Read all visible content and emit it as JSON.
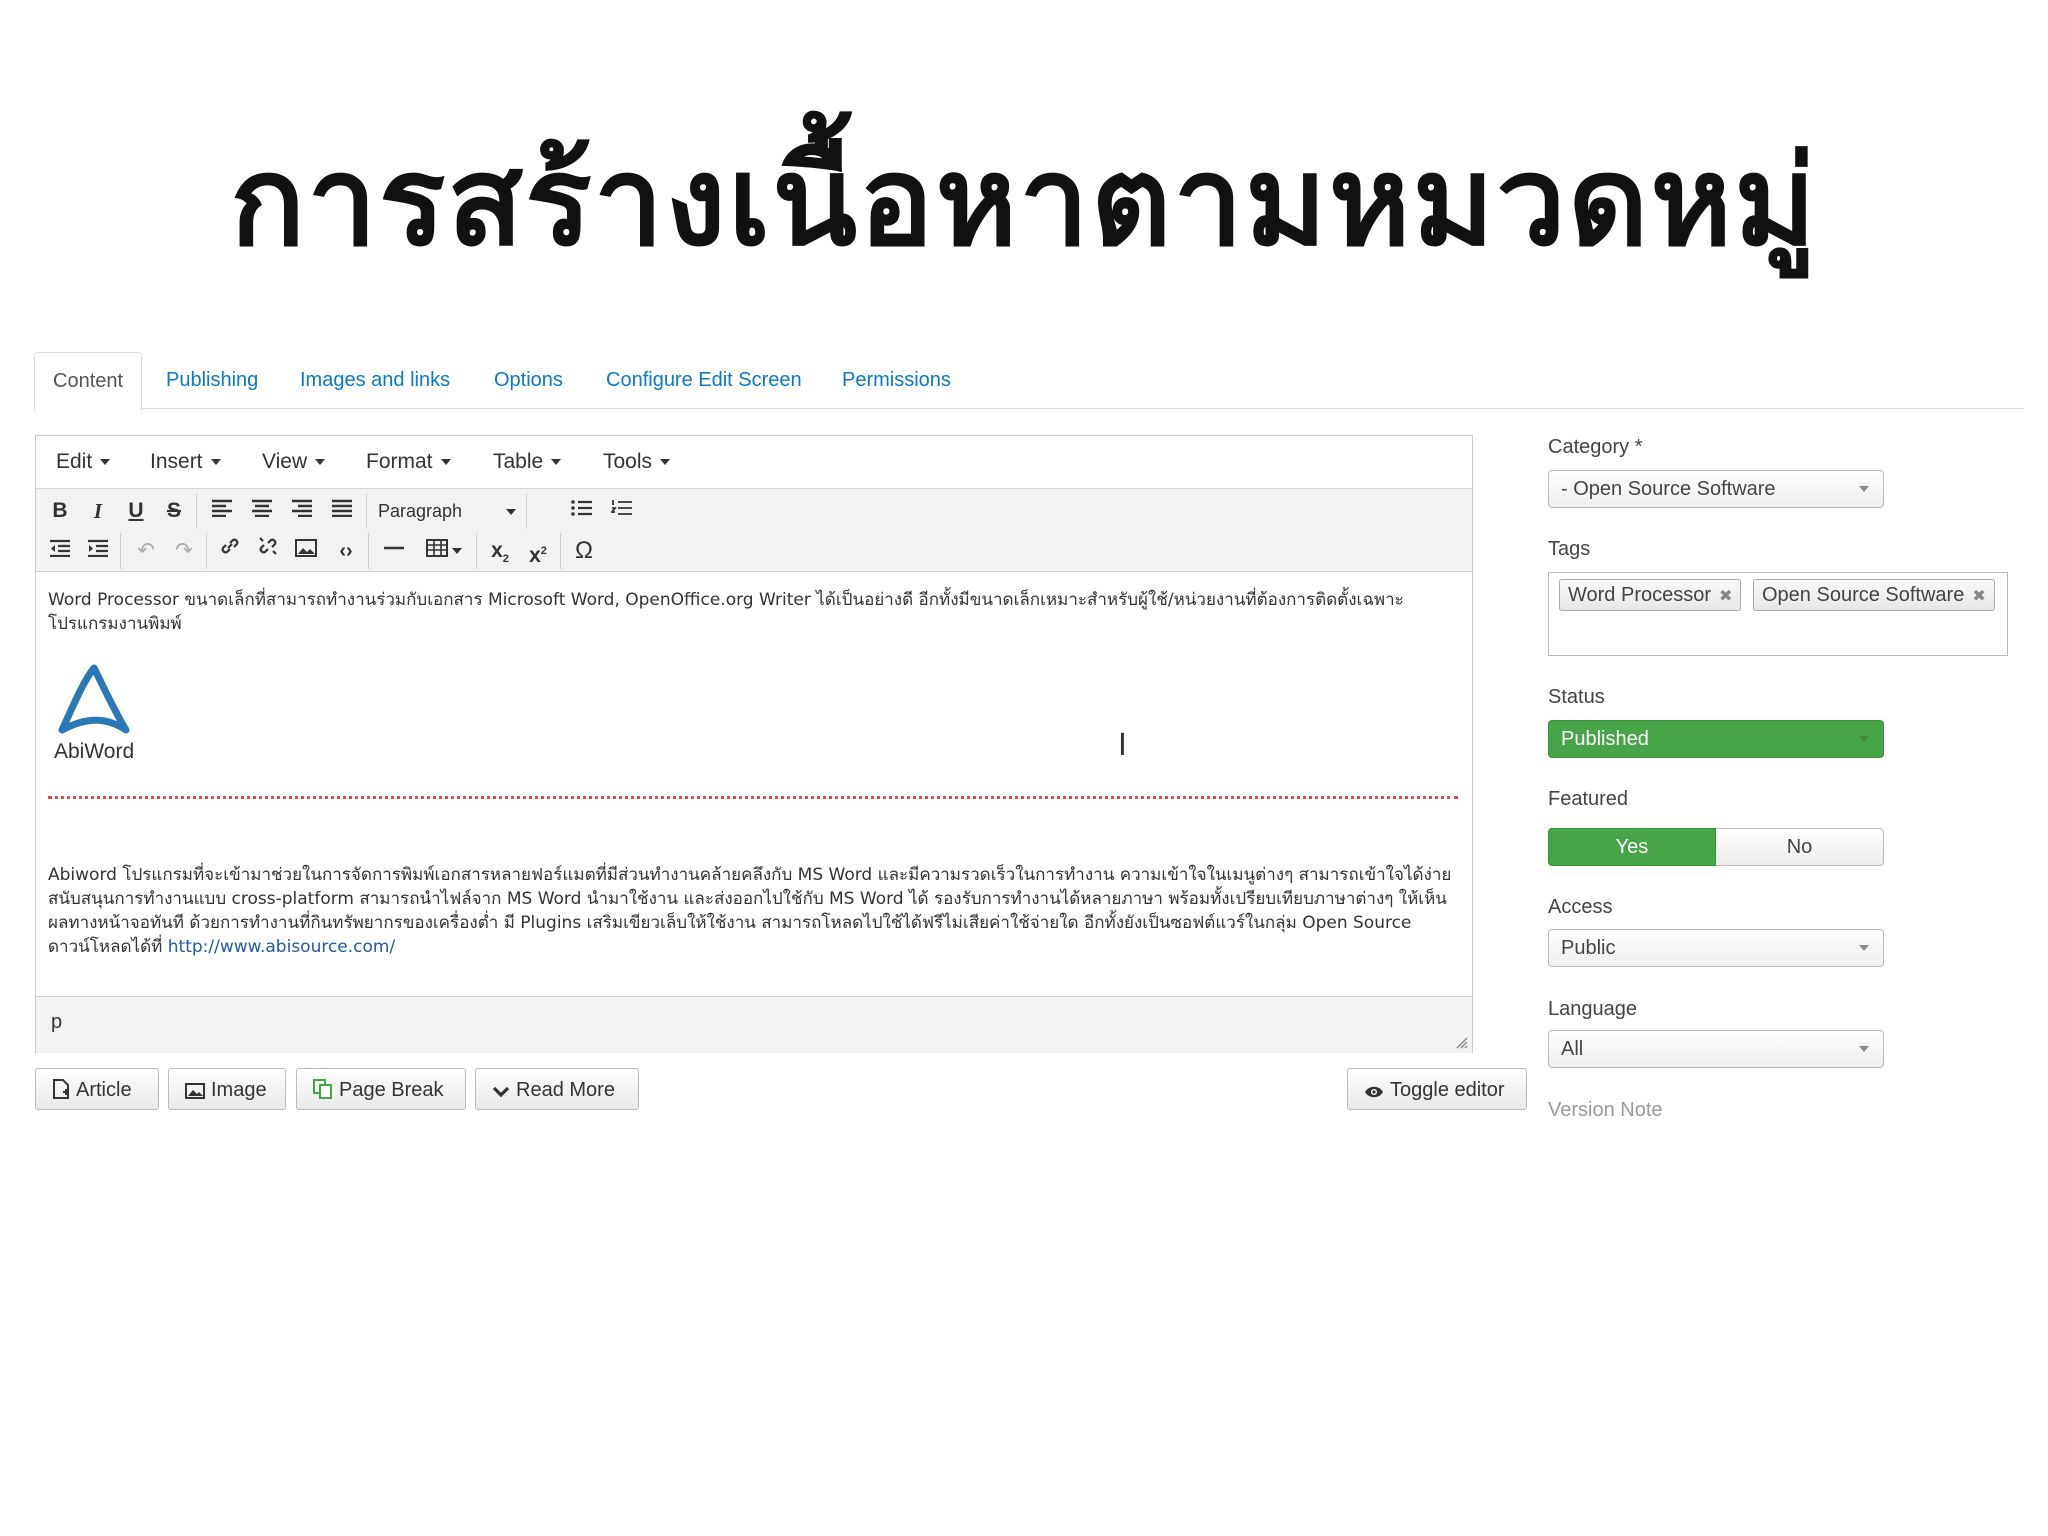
{
  "slide": {
    "title": "การสร้างเนื้อหาตามหมวดหมู่"
  },
  "tabs": [
    "Content",
    "Publishing",
    "Images and links",
    "Options",
    "Configure Edit Screen",
    "Permissions"
  ],
  "editor": {
    "menu": [
      "Edit",
      "Insert",
      "View",
      "Format",
      "Table",
      "Tools"
    ],
    "format_select": "Paragraph",
    "para1": "Word Processor ขนาดเล็กที่สามารถทำงานร่วมกับเอกสาร Microsoft Word, OpenOffice.org Writer ได้เป็นอย่างดี อีกทั้งมีขนาดเล็กเหมาะสำหรับผู้ใช้/หน่วยงานที่ต้องการติดตั้งเฉพาะโปรแกรมงานพิมพ์",
    "logo_text": "AbiWord",
    "para2": "Abiword โปรแกรมที่จะเข้ามาช่วยในการจัดการพิมพ์เอกสารหลายฟอร์แมตที่มีส่วนทำงานคล้ายคลึงกับ MS Word และมีความรวดเร็วในการทำงาน ความเข้าใจในเมนูต่างๆ สามารถเข้าใจได้ง่าย สนับสนุนการทำงานแบบ cross-platform สามารถนำไฟล์จาก MS Word นำมาใช้งาน และส่งออกไปใช้กับ MS Word ได้ รองรับการทำงานได้หลายภาษา พร้อมทั้งเปรียบเทียบภาษาต่างๆ ให้เห็นผลทางหน้าจอทันที ด้วยการทำงานที่กินทรัพยากรของเครื่องต่ำ มี Plugins เสริมเขียวเล็บให้ใช้งาน สามารถโหลดไปใช้ได้ฟรีไม่เสียค่าใช้จ่ายใด อีกทั้งยังเป็นซอฟต์แวร์ในกลุ่ม Open Source ดาวน์โหลดได้ที่ ",
    "link": "http://www.abisource.com/",
    "path": "p"
  },
  "buttons": {
    "article": "Article",
    "image": "Image",
    "page_break": "Page Break",
    "read_more": "Read More",
    "toggle_editor": "Toggle editor"
  },
  "sidebar": {
    "category_label": "Category *",
    "category_value": "- Open Source Software",
    "tags_label": "Tags",
    "tags": [
      "Word Processor",
      "Open Source Software"
    ],
    "status_label": "Status",
    "status_value": "Published",
    "featured_label": "Featured",
    "featured_yes": "Yes",
    "featured_no": "No",
    "featured_selected": "Yes",
    "access_label": "Access",
    "access_value": "Public",
    "language_label": "Language",
    "language_value": "All",
    "version_note_label": "Version Note"
  },
  "colors": {
    "link": "#0a79c9",
    "green": "#46a546",
    "page_break": "#e04a4a"
  }
}
